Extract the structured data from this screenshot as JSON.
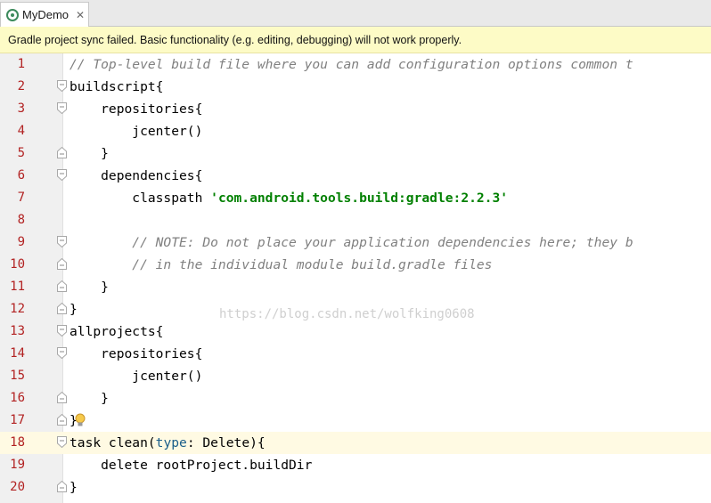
{
  "tab": {
    "title": "MyDemo",
    "close_glyph": "✕",
    "icon": "android-studio-module-icon"
  },
  "notification": {
    "text": "Gradle project sync failed. Basic functionality (e.g. editing, debugging) will not work properly."
  },
  "editor": {
    "current_line": 18,
    "lines": [
      {
        "n": "1",
        "fold": "none",
        "parts": [
          {
            "t": "// Top-level build file where you can add configuration options common t",
            "c": "cmt"
          }
        ],
        "indent": 0
      },
      {
        "n": "2",
        "fold": "open",
        "parts": [
          {
            "t": "buildscript{",
            "c": "kw"
          }
        ],
        "indent": 0
      },
      {
        "n": "3",
        "fold": "open",
        "parts": [
          {
            "t": "    repositories{",
            "c": "kw"
          }
        ],
        "indent": 0
      },
      {
        "n": "4",
        "fold": "none",
        "parts": [
          {
            "t": "        jcenter()",
            "c": "kw"
          }
        ],
        "indent": 0
      },
      {
        "n": "5",
        "fold": "close",
        "parts": [
          {
            "t": "    }",
            "c": "kw"
          }
        ],
        "indent": 0
      },
      {
        "n": "6",
        "fold": "open",
        "parts": [
          {
            "t": "    dependencies{",
            "c": "kw"
          }
        ],
        "indent": 0
      },
      {
        "n": "7",
        "fold": "none",
        "parts": [
          {
            "t": "        classpath ",
            "c": "kw"
          },
          {
            "t": "'com.android.tools.build:gradle:2.2.3'",
            "c": "str"
          }
        ],
        "indent": 0
      },
      {
        "n": "8",
        "fold": "none",
        "parts": [
          {
            "t": "",
            "c": "kw"
          }
        ],
        "indent": 0
      },
      {
        "n": "9",
        "fold": "open",
        "parts": [
          {
            "t": "        // NOTE: Do not place your application dependencies here; they b",
            "c": "cmt"
          }
        ],
        "indent": 0
      },
      {
        "n": "10",
        "fold": "close",
        "parts": [
          {
            "t": "        // in the individual module build.gradle files",
            "c": "cmt"
          }
        ],
        "indent": 0
      },
      {
        "n": "11",
        "fold": "close",
        "parts": [
          {
            "t": "    }",
            "c": "kw"
          }
        ],
        "indent": 0
      },
      {
        "n": "12",
        "fold": "close",
        "parts": [
          {
            "t": "}",
            "c": "kw"
          }
        ],
        "indent": 0
      },
      {
        "n": "13",
        "fold": "open",
        "parts": [
          {
            "t": "allprojects{",
            "c": "kw"
          }
        ],
        "indent": 0
      },
      {
        "n": "14",
        "fold": "open",
        "parts": [
          {
            "t": "    repositories{",
            "c": "kw"
          }
        ],
        "indent": 0
      },
      {
        "n": "15",
        "fold": "none",
        "parts": [
          {
            "t": "        jcenter()",
            "c": "kw"
          }
        ],
        "indent": 0
      },
      {
        "n": "16",
        "fold": "close",
        "parts": [
          {
            "t": "    }",
            "c": "kw"
          }
        ],
        "indent": 0
      },
      {
        "n": "17",
        "fold": "close",
        "parts": [
          {
            "t": "}",
            "c": "kw"
          }
        ],
        "indent": 0,
        "bulb": true
      },
      {
        "n": "18",
        "fold": "open",
        "parts": [
          {
            "t": "task clean(",
            "c": "kw"
          },
          {
            "t": "type",
            "c": "named"
          },
          {
            "t": ": Delete){",
            "c": "kw"
          }
        ],
        "indent": 0
      },
      {
        "n": "19",
        "fold": "none",
        "parts": [
          {
            "t": "    delete rootProject.buildDir",
            "c": "kw"
          }
        ],
        "indent": 0
      },
      {
        "n": "20",
        "fold": "close",
        "parts": [
          {
            "t": "}",
            "c": "kw"
          }
        ],
        "indent": 0
      }
    ]
  },
  "watermark": "https://blog.csdn.net/wolfking0608",
  "colors": {
    "line_number": "#b22222",
    "comment": "#808080",
    "string": "#008000",
    "notification_bg": "#fdfbc6",
    "current_line_bg": "#fffae3"
  }
}
